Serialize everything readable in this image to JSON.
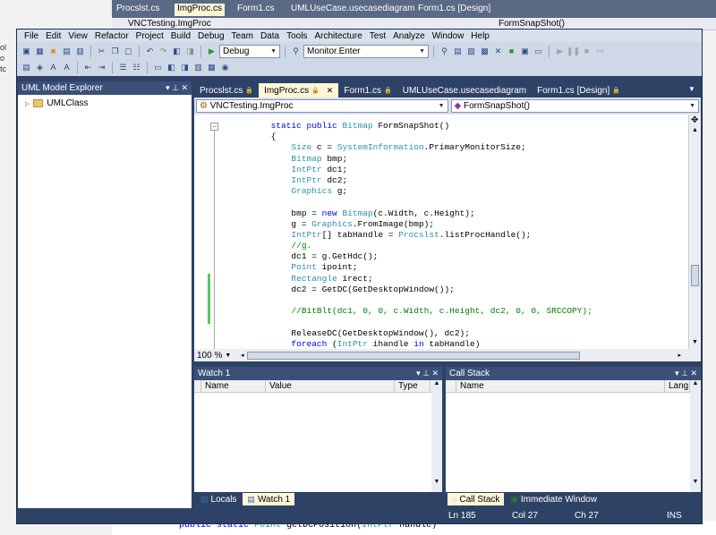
{
  "background": {
    "tabs": [
      "Procslst.cs",
      "ImgProc.cs",
      "Form1.cs",
      "UMLUseCase.usecasediagram",
      "Form1.cs [Design]"
    ],
    "class_path": "VNCTesting.ImgProc",
    "method": "FormSnapShot()",
    "frag": [
      "ol",
      "o",
      "tc"
    ],
    "bottom_code": {
      "kw1": "public",
      "kw2": "static",
      "type": "Point",
      "name": "getDCPosition(",
      "ptype": "IntPtr",
      "rest": "handle)"
    }
  },
  "menu": [
    "File",
    "Edit",
    "View",
    "Refactor",
    "Project",
    "Build",
    "Debug",
    "Team",
    "Data",
    "Tools",
    "Architecture",
    "Test",
    "Analyze",
    "Window",
    "Help"
  ],
  "toolbar": {
    "config": "Debug",
    "find": "Monitor.Enter"
  },
  "explorer": {
    "title": "UML Model Explorer",
    "item": "UMLClass"
  },
  "editor_tabs": [
    {
      "label": "Procslst.cs",
      "active": false
    },
    {
      "label": "ImgProc.cs",
      "active": true
    },
    {
      "label": "Form1.cs",
      "active": false
    },
    {
      "label": "UMLUseCase.usecasediagram",
      "active": false
    },
    {
      "label": "Form1.cs [Design]",
      "active": false
    }
  ],
  "nav": {
    "type": "VNCTesting.ImgProc",
    "member": "FormSnapShot()"
  },
  "code": [
    [
      [
        "        ",
        ""
      ],
      [
        "static public ",
        "kw"
      ],
      [
        "Bitmap",
        "ty"
      ],
      [
        " FormSnapShot()",
        ""
      ]
    ],
    [
      [
        "        {",
        ""
      ]
    ],
    [
      [
        "            ",
        ""
      ],
      [
        "Size",
        "ty"
      ],
      [
        " c = ",
        ""
      ],
      [
        "SystemInformation",
        "ty"
      ],
      [
        ".PrimaryMonitorSize;",
        ""
      ]
    ],
    [
      [
        "            ",
        ""
      ],
      [
        "Bitmap",
        "ty"
      ],
      [
        " bmp;",
        ""
      ]
    ],
    [
      [
        "            ",
        ""
      ],
      [
        "IntPtr",
        "ty"
      ],
      [
        " dc1;",
        ""
      ]
    ],
    [
      [
        "            ",
        ""
      ],
      [
        "IntPtr",
        "ty"
      ],
      [
        " dc2;",
        ""
      ]
    ],
    [
      [
        "            ",
        ""
      ],
      [
        "Graphics",
        "ty"
      ],
      [
        " g;",
        ""
      ]
    ],
    [
      [
        "",
        ""
      ]
    ],
    [
      [
        "            bmp = ",
        ""
      ],
      [
        "new ",
        "kw"
      ],
      [
        "Bitmap",
        "ty"
      ],
      [
        "(c.Width, c.Height);",
        ""
      ]
    ],
    [
      [
        "            g = ",
        ""
      ],
      [
        "Graphics",
        "ty"
      ],
      [
        ".FromImage(bmp);",
        ""
      ]
    ],
    [
      [
        "            ",
        ""
      ],
      [
        "IntPtr",
        "ty"
      ],
      [
        "[] tabHandle = ",
        ""
      ],
      [
        "Procslst",
        "ty"
      ],
      [
        ".listProcHandle();",
        ""
      ]
    ],
    [
      [
        "            ",
        ""
      ],
      [
        "//g.",
        "cm"
      ]
    ],
    [
      [
        "            dc1 = g.GetHdc();",
        ""
      ]
    ],
    [
      [
        "            ",
        ""
      ],
      [
        "Point",
        "ty"
      ],
      [
        " ipoint;",
        ""
      ]
    ],
    [
      [
        "            ",
        ""
      ],
      [
        "Rectangle",
        "ty"
      ],
      [
        " irect;",
        ""
      ]
    ],
    [
      [
        "            dc2 = GetDC(GetDesktopWindow());",
        ""
      ]
    ],
    [
      [
        "",
        ""
      ]
    ],
    [
      [
        "            ",
        ""
      ],
      [
        "//BitBlt(dc1, 0, 0, c.Width, c.Height, dc2, 0, 0, SRCCOPY);",
        "cm"
      ]
    ],
    [
      [
        "",
        ""
      ]
    ],
    [
      [
        "            ReleaseDC(GetDesktopWindow(), dc2);",
        ""
      ]
    ],
    [
      [
        "            ",
        ""
      ],
      [
        "foreach",
        "kw"
      ],
      [
        " (",
        ""
      ],
      [
        "IntPtr",
        "ty"
      ],
      [
        " ihandle ",
        ""
      ],
      [
        "in",
        "kw"
      ],
      [
        " tabHandle)",
        ""
      ]
    ]
  ],
  "zoom": "100 %",
  "watch": {
    "title": "Watch 1",
    "cols": [
      "Name",
      "Value",
      "Type"
    ]
  },
  "callstack": {
    "title": "Call Stack",
    "cols": [
      "Name",
      "Lang"
    ]
  },
  "bottom_tabs_left": [
    {
      "label": "Locals",
      "active": false
    },
    {
      "label": "Watch 1",
      "active": true
    }
  ],
  "bottom_tabs_right": [
    {
      "label": "Call Stack",
      "active": true
    },
    {
      "label": "Immediate Window",
      "active": false
    }
  ],
  "status": {
    "ln": "Ln 185",
    "col": "Col 27",
    "ch": "Ch 27",
    "ins": "INS"
  }
}
